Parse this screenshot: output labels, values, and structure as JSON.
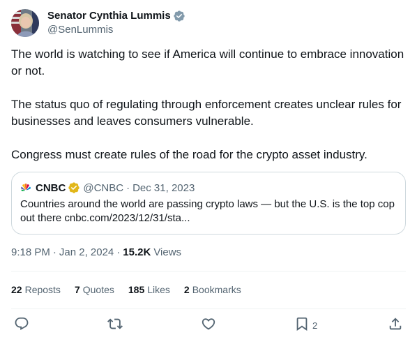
{
  "author": {
    "display_name": "Senator Cynthia Lummis",
    "handle": "@SenLummis",
    "verified_icon": "verified-badge-gray",
    "verified_color": "#829aab"
  },
  "tweet": {
    "paragraphs": [
      "The world is watching to see if America will continue to embrace innovation or not.",
      "The status quo of regulating through enforcement creates unclear rules for businesses and leaves consumers vulnerable.",
      "Congress must create rules of the road for the crypto asset industry."
    ]
  },
  "quote": {
    "logo_icon": "nbc-peacock-icon",
    "name": "CNBC",
    "badge_icon": "verified-badge-gold",
    "badge_color": "#e2b719",
    "handle": "@CNBC",
    "separator": "·",
    "date": "Dec 31, 2023",
    "text": "Countries around the world are passing crypto laws — but the U.S. is the top cop out there cnbc.com/2023/12/31/sta..."
  },
  "meta": {
    "time": "9:18 PM",
    "dot1": "·",
    "date": "Jan 2, 2024",
    "dot2": "·",
    "views_count": "15.2K",
    "views_label": "Views"
  },
  "stats": {
    "reposts": {
      "count": "22",
      "label": "Reposts"
    },
    "quotes": {
      "count": "7",
      "label": "Quotes"
    },
    "likes": {
      "count": "185",
      "label": "Likes"
    },
    "bookmarks": {
      "count": "2",
      "label": "Bookmarks"
    }
  },
  "actions": {
    "reply_icon": "reply-icon",
    "repost_icon": "repost-icon",
    "like_icon": "like-heart-icon",
    "bookmark_icon": "bookmark-icon",
    "bookmark_count": "2",
    "share_icon": "share-icon"
  },
  "colors": {
    "text_primary": "#0f1419",
    "text_secondary": "#536471",
    "border": "#cfd9de",
    "divider": "#eff3f4"
  }
}
